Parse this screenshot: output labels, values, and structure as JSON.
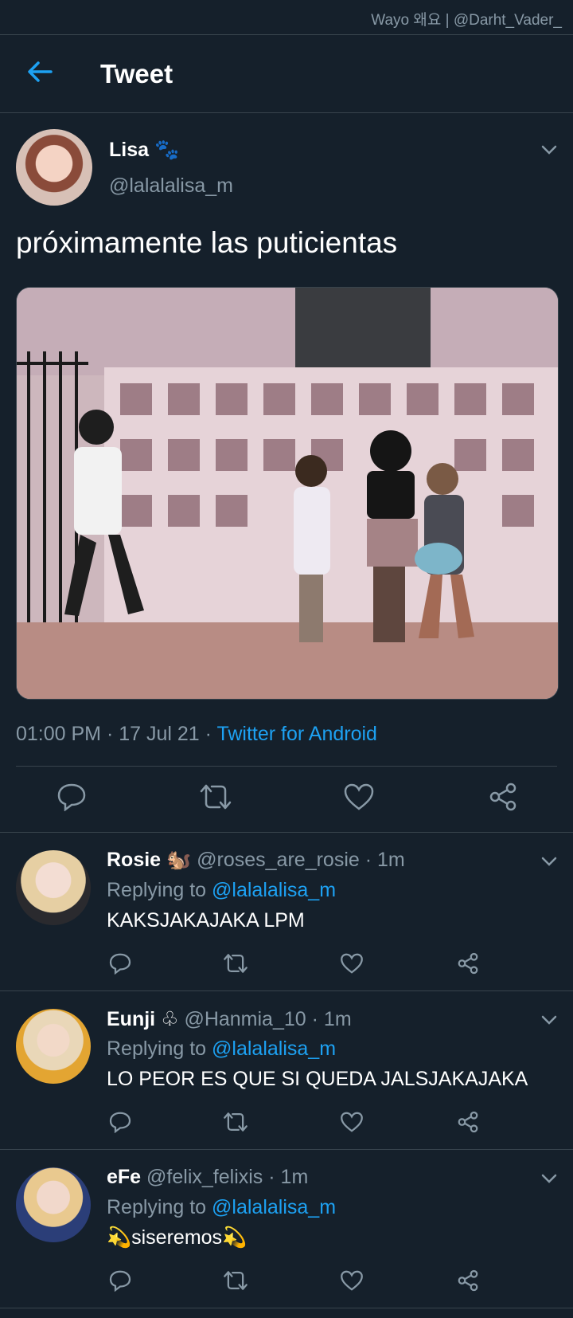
{
  "watermark": "Wayo 왜요 | @Darht_Vader_",
  "header": {
    "title": "Tweet",
    "back_icon": "arrow-left-icon"
  },
  "tweet": {
    "author_name": "Lisa",
    "author_emoji": "🐾",
    "handle": "@lalalalisa_m",
    "text": "próximamente las puticientas",
    "time": "01:00 PM · 17 Jul 21 · ",
    "source": "Twitter for Android"
  },
  "colors": {
    "background": "#15202b",
    "accent": "#1da1f2",
    "muted": "#8899a6",
    "divider": "#38444d"
  },
  "replies": [
    {
      "name": "Rosie",
      "emoji": "🐿️",
      "handle": "@roses_are_rosie",
      "time": "· 1m",
      "replying_label": "Replying to ",
      "replying_to": "@lalalalisa_m",
      "text": "KAKSJAKAJAKA LPM"
    },
    {
      "name": "Eunji",
      "emoji": "♧",
      "handle": "@Hanmia_10",
      "time": "· 1m",
      "replying_label": "Replying to ",
      "replying_to": "@lalalalisa_m",
      "text": "LO PEOR ES QUE SI QUEDA JALSJAKAJAKA"
    },
    {
      "name": "eFe",
      "emoji": "",
      "handle": "@felix_felixis",
      "time": "· 1m",
      "replying_label": "Replying to ",
      "replying_to": "@lalalalisa_m",
      "text": "💫siseremos💫"
    }
  ]
}
